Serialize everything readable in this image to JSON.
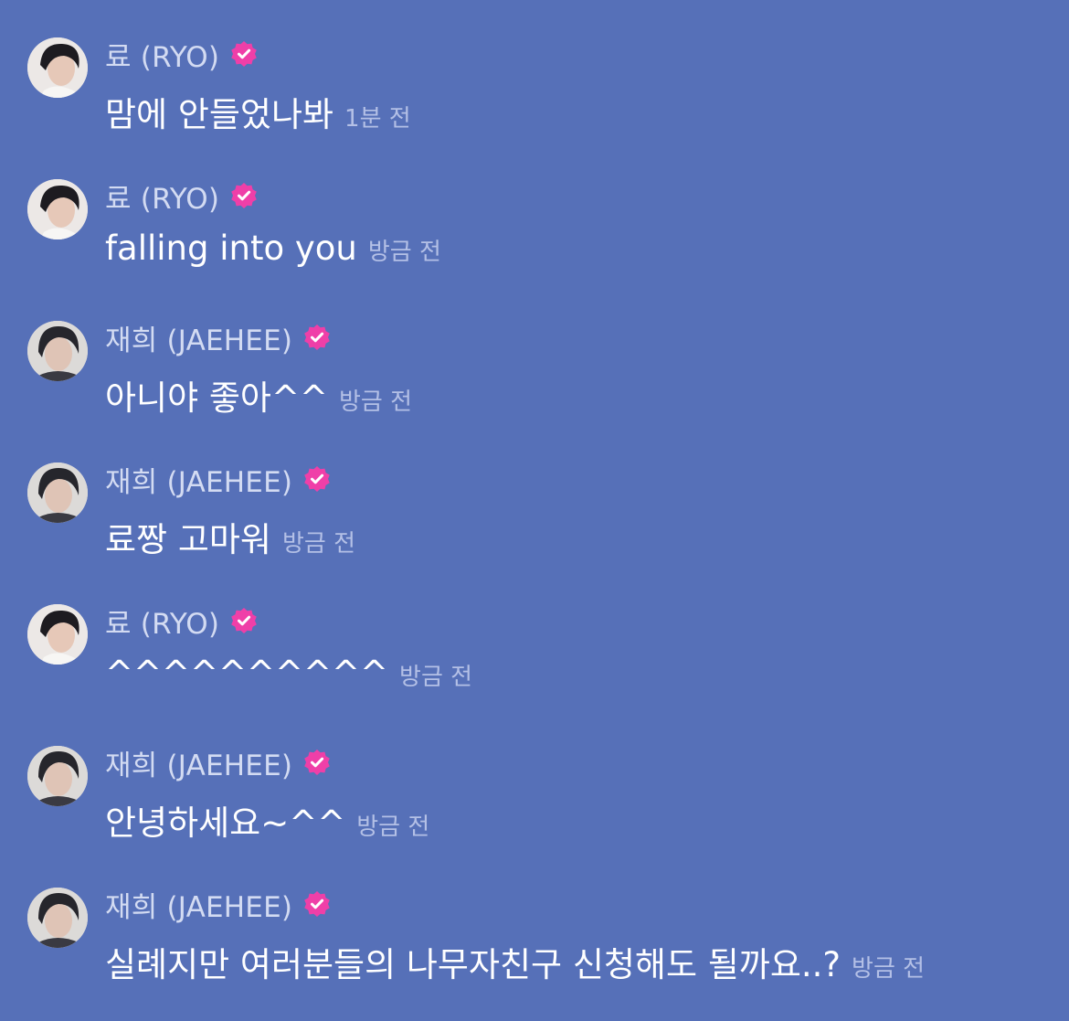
{
  "messages": [
    {
      "author": "료 (RYO)",
      "avatar": "ryo-avatar",
      "text": "맘에 안들었나봐",
      "time": "1분 전"
    },
    {
      "author": "료 (RYO)",
      "avatar": "ryo-avatar",
      "text": "falling into you",
      "time": "방금 전"
    },
    {
      "author": "재희 (JAEHEE)",
      "avatar": "jaehee-avatar",
      "text": "아니야 좋아^^",
      "time": "방금 전"
    },
    {
      "author": "재희 (JAEHEE)",
      "avatar": "jaehee-avatar",
      "text": "료짱 고마워",
      "time": "방금 전"
    },
    {
      "author": "료 (RYO)",
      "avatar": "ryo-avatar",
      "text": "^^^^^^^^^^",
      "time": "방금 전"
    },
    {
      "author": "재희 (JAEHEE)",
      "avatar": "jaehee-avatar",
      "text": "안녕하세요~^^",
      "time": "방금 전"
    },
    {
      "author": "재희 (JAEHEE)",
      "avatar": "jaehee-avatar",
      "text": "실례지만 여러분들의 나무자친구 신청해도 될까요..?",
      "time": "방금 전"
    }
  ],
  "icons": {
    "verified": "verified-badge-icon"
  },
  "colors": {
    "background": "#5670b8",
    "name": "#d3dbf2",
    "message": "#ffffff",
    "timestamp": "#b4c0e6",
    "verified_badge": "#ef3fa8"
  }
}
